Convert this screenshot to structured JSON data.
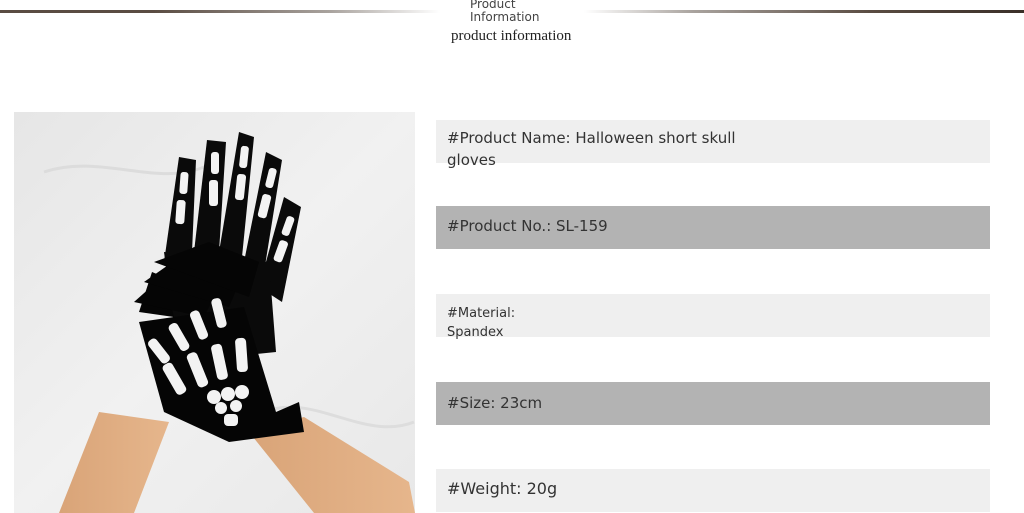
{
  "header": {
    "title_en": "Product Information",
    "subtitle": "product information"
  },
  "product_image": {
    "icon": "skeleton-gloves-photo"
  },
  "info": {
    "name": "#Product Name: Halloween short skull gloves",
    "number": "#Product No.: SL-159",
    "material": "#Material:\nSpandex",
    "size": "#Size: 23cm",
    "weight": "#Weight: 20g"
  },
  "colors": {
    "row_light": "#efefef",
    "row_dark": "#b3b3b3",
    "text": "#333333",
    "rule": "#5a4c42"
  }
}
